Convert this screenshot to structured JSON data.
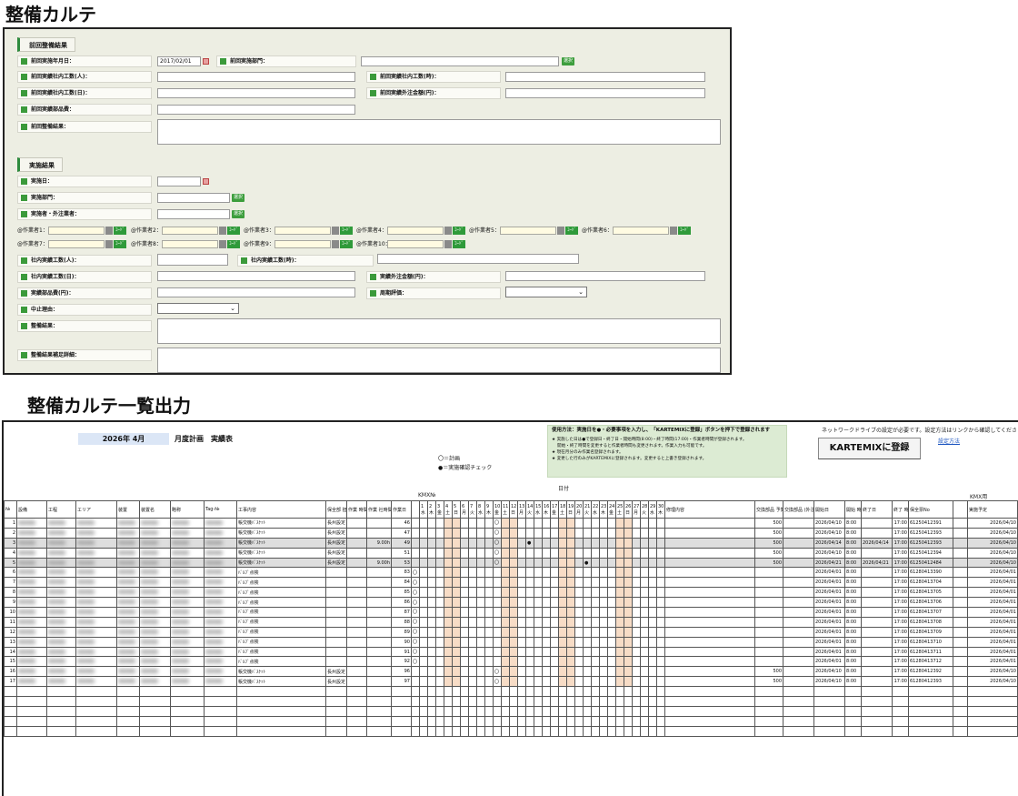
{
  "karte": {
    "title": "整備カルテ",
    "previous": {
      "section": "前回整備結果",
      "date_label": "前回実施年月日：",
      "date_value": "2017/02/01",
      "dept_label": "前回実施部門：",
      "select_btn": "選択",
      "in_persons_label": "前回実績社内工数(人)：",
      "in_hours_label": "前回実績社内工数(時)：",
      "in_days_label": "前回実績社内工数(日)：",
      "out_amount_label": "前回実績外注金額(円)：",
      "parts_label": "前回実績部品費：",
      "result_label": "前回整備結果："
    },
    "current": {
      "section": "実施結果",
      "date_label": "実施日：",
      "dept_label": "実施部門：",
      "person_label": "実施者・外注業者：",
      "select_btn": "選択",
      "workers": [
        "@作業者1：",
        "@作業者2：",
        "@作業者3：",
        "@作業者4：",
        "@作業者5：",
        "@作業者6：",
        "@作業者7：",
        "@作業者8：",
        "@作業者9：",
        "@作業者10："
      ],
      "code_btn": "ｺｰﾄﾞ",
      "in_persons_label": "社内実績工数(人)：",
      "in_hours_label": "社内実績工数(時)：",
      "in_days_label": "社内実績工数(日)：",
      "out_amount_label": "実績外注金額(円)：",
      "parts_label": "実績部品費(円)：",
      "cycle_label": "周期評価：",
      "stop_label": "中止理由：",
      "result_label": "整備結果：",
      "result_detail_label": "整備結果補足詳細："
    }
  },
  "list": {
    "title": "整備カルテ一覧出力",
    "month": "2026年 4月",
    "plan_label": "月度計画　実績表",
    "legend_plan": "〇＝計画",
    "legend_done": "●＝実施確認チェック",
    "guide_title": "使用方法：実施日を●・必要事項を入力し、「KARTEMIXに登録」ボタンを押下で登録されます",
    "guide_lines": [
      "★ 実施した日は●で登録日・終了日・開始時間(8:00)・終了時間(17:00)・作業者時間が登録されます。",
      "　 開始・終了時間を変更すると作業者時間も変更されます。作業入力も可能です。",
      "★ 現在月分のみ作業名登録されます。",
      "★ 変更した行のみがKARTEMIXに登録されます。変更すると上書き登録されます。"
    ],
    "register_btn": "KARTEMIXに登録",
    "network_note": "ネットワークドライブの設定が必要です。設定方法はリンクから確認してください",
    "setting_link": "設定方法",
    "kmx_label": "KMX用",
    "kmx_no_label": "KMX№",
    "month_days_label": "日付",
    "headers": [
      "№",
      "設備",
      "工程",
      "エリア",
      "装置",
      "装置名",
      "略称",
      "Tag-№",
      "工事内容",
      "保全部\n担当",
      "作業\n時間",
      "作業\n社時間",
      "作業日"
    ],
    "h_work_content": "修理内容",
    "h_parts": "交換部品\n予算金額(千円)",
    "h_parts2": "交換部品\n(外注)",
    "h_start": "開始日",
    "h_start_t": "開始\n時間",
    "h_end": "終了日",
    "h_end_t": "終了\n時間",
    "h_card": "保全票No",
    "h_kmx": "実施予定",
    "days": [
      "1",
      "2",
      "3",
      "4",
      "5",
      "6",
      "7",
      "8",
      "9",
      "10",
      "11",
      "12",
      "13",
      "14",
      "15",
      "16",
      "17",
      "18",
      "19",
      "20",
      "21",
      "22",
      "23",
      "24",
      "25",
      "26",
      "27",
      "28",
      "29",
      "30"
    ],
    "weekdays": [
      "水",
      "木",
      "金",
      "土",
      "日",
      "月",
      "火",
      "水",
      "木",
      "金",
      "土",
      "日",
      "月",
      "火",
      "水",
      "木",
      "金",
      "土",
      "日",
      "月",
      "火",
      "水",
      "木",
      "金",
      "土",
      "日",
      "月",
      "火",
      "水",
      "木"
    ],
    "rows": [
      {
        "no": "1",
        "work": "帳交機ﾊﾞｽｹｯﾄ",
        "dept": "長州設定",
        "hours": "",
        "no2": "46",
        "plan": "",
        "done": "",
        "budget": "500",
        "start": "2026/04/10",
        "st": "8:00",
        "end": "",
        "et": "17:00",
        "card": "61250412391",
        "kmx": "2026/04/10"
      },
      {
        "no": "2",
        "work": "帳交機ﾊﾞｽｹｯﾄ",
        "dept": "長州設定",
        "hours": "",
        "no2": "47",
        "plan": "",
        "done": "",
        "budget": "500",
        "start": "2026/04/10",
        "st": "8:00",
        "end": "",
        "et": "17:00",
        "card": "61250412393",
        "kmx": "2026/04/10"
      },
      {
        "no": "3",
        "work": "帳交機ﾊﾞｽｹｯﾄ",
        "dept": "長州設定",
        "hours": "9.00h",
        "no2": "49",
        "plan": "",
        "done": "●",
        "budget": "500",
        "start": "2026/04/14",
        "st": "8:00",
        "end": "2026/04/14",
        "et": "17:00",
        "card": "61250412393",
        "kmx": "2026/04/10"
      },
      {
        "no": "4",
        "work": "帳交機ﾊﾞｽｹｯﾄ",
        "dept": "長州設定",
        "hours": "",
        "no2": "51",
        "plan": "",
        "done": "",
        "budget": "500",
        "start": "2026/04/10",
        "st": "8:00",
        "end": "",
        "et": "17:00",
        "card": "61250412394",
        "kmx": "2026/04/10"
      },
      {
        "no": "5",
        "work": "帳交機ﾊﾞｽｹｯﾄ",
        "dept": "長州設定",
        "hours": "9.00h",
        "no2": "53",
        "plan": "",
        "done": "●",
        "budget": "500",
        "start": "2026/04/21",
        "st": "8:00",
        "end": "2026/04/21",
        "et": "17:00",
        "card": "61250412484",
        "kmx": "2026/04/10"
      },
      {
        "no": "6",
        "work": "ﾊﾞﾙﾌﾞ点検",
        "dept": "",
        "hours": "",
        "no2": "83",
        "plan": "〇",
        "done": "",
        "budget": "",
        "start": "2026/04/01",
        "st": "8:00",
        "end": "",
        "et": "17:00",
        "card": "61280413390",
        "kmx": "2026/04/01"
      },
      {
        "no": "7",
        "work": "ﾊﾞﾙﾌﾞ点検",
        "dept": "",
        "hours": "",
        "no2": "84",
        "plan": "〇",
        "done": "",
        "budget": "",
        "start": "2026/04/01",
        "st": "8:00",
        "end": "",
        "et": "17:00",
        "card": "61280413704",
        "kmx": "2026/04/01"
      },
      {
        "no": "8",
        "work": "ﾊﾞﾙﾌﾞ点検",
        "dept": "",
        "hours": "",
        "no2": "85",
        "plan": "〇",
        "done": "",
        "budget": "",
        "start": "2026/04/01",
        "st": "8:00",
        "end": "",
        "et": "17:00",
        "card": "61280413705",
        "kmx": "2026/04/01"
      },
      {
        "no": "9",
        "work": "ﾊﾞﾙﾌﾞ点検",
        "dept": "",
        "hours": "",
        "no2": "86",
        "plan": "〇",
        "done": "",
        "budget": "",
        "start": "2026/04/01",
        "st": "8:00",
        "end": "",
        "et": "17:00",
        "card": "61280413706",
        "kmx": "2026/04/01"
      },
      {
        "no": "10",
        "work": "ﾊﾞﾙﾌﾞ点検",
        "dept": "",
        "hours": "",
        "no2": "87",
        "plan": "〇",
        "done": "",
        "budget": "",
        "start": "2026/04/01",
        "st": "8:00",
        "end": "",
        "et": "17:00",
        "card": "61280413707",
        "kmx": "2026/04/01"
      },
      {
        "no": "11",
        "work": "ﾊﾞﾙﾌﾞ点検",
        "dept": "",
        "hours": "",
        "no2": "88",
        "plan": "〇",
        "done": "",
        "budget": "",
        "start": "2026/04/01",
        "st": "8:00",
        "end": "",
        "et": "17:00",
        "card": "61280413708",
        "kmx": "2026/04/01"
      },
      {
        "no": "12",
        "work": "ﾊﾞﾙﾌﾞ点検",
        "dept": "",
        "hours": "",
        "no2": "89",
        "plan": "〇",
        "done": "",
        "budget": "",
        "start": "2026/04/01",
        "st": "8:00",
        "end": "",
        "et": "17:00",
        "card": "61280413709",
        "kmx": "2026/04/01"
      },
      {
        "no": "13",
        "work": "ﾊﾞﾙﾌﾞ点検",
        "dept": "",
        "hours": "",
        "no2": "90",
        "plan": "〇",
        "done": "",
        "budget": "",
        "start": "2026/04/01",
        "st": "8:00",
        "end": "",
        "et": "17:00",
        "card": "61280413710",
        "kmx": "2026/04/01"
      },
      {
        "no": "14",
        "work": "ﾊﾞﾙﾌﾞ点検",
        "dept": "",
        "hours": "",
        "no2": "91",
        "plan": "〇",
        "done": "",
        "budget": "",
        "start": "2026/04/01",
        "st": "8:00",
        "end": "",
        "et": "17:00",
        "card": "61280413711",
        "kmx": "2026/04/01"
      },
      {
        "no": "15",
        "work": "ﾊﾞﾙﾌﾞ点検",
        "dept": "",
        "hours": "",
        "no2": "92",
        "plan": "〇",
        "done": "",
        "budget": "",
        "start": "2026/04/01",
        "st": "8:00",
        "end": "",
        "et": "17:00",
        "card": "61280413712",
        "kmx": "2026/04/01"
      },
      {
        "no": "16",
        "work": "帳交機ﾊﾞｽｹｯﾄ",
        "dept": "長州設定",
        "hours": "",
        "no2": "96",
        "plan": "",
        "done": "",
        "budget": "500",
        "start": "2026/04/10",
        "st": "8:00",
        "end": "",
        "et": "17:00",
        "card": "61280412392",
        "kmx": "2026/04/10"
      },
      {
        "no": "17",
        "work": "帳交機ﾊﾞｽｹｯﾄ",
        "dept": "長州設定",
        "hours": "",
        "no2": "97",
        "plan": "",
        "done": "",
        "budget": "500",
        "start": "2026/04/10",
        "st": "8:00",
        "end": "",
        "et": "17:00",
        "card": "61280412393",
        "kmx": "2026/04/10"
      }
    ]
  }
}
